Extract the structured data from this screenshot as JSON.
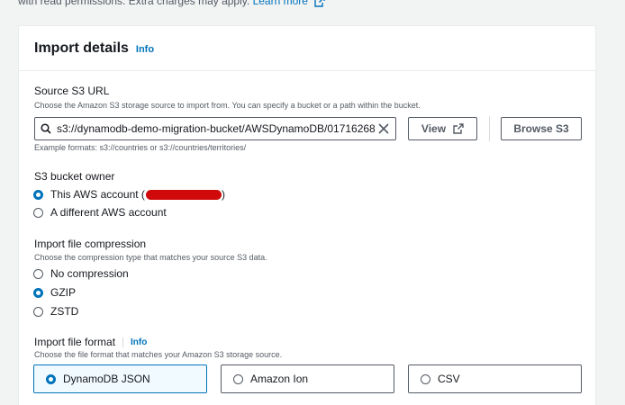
{
  "top_note": {
    "text": "with read permissions. Extra charges may apply.",
    "link": "Learn more"
  },
  "panel": {
    "title": "Import details",
    "info": "Info"
  },
  "source_s3": {
    "label": "Source S3 URL",
    "description": "Choose the Amazon S3 storage source to import from. You can specify a bucket or a path within the bucket.",
    "value": "s3://dynamodb-demo-migration-bucket/AWSDynamoDB/01716268",
    "example": "Example formats: s3://countries or s3://countries/territories/",
    "view_button": "View",
    "browse_button": "Browse S3"
  },
  "bucket_owner": {
    "label": "S3 bucket owner",
    "options": [
      "This AWS account (",
      "A different AWS account"
    ],
    "selected": 0,
    "closing": ")"
  },
  "compression": {
    "label": "Import file compression",
    "description": "Choose the compression type that matches your source S3 data.",
    "options": [
      "No compression",
      "GZIP",
      "ZSTD"
    ],
    "selected": 1
  },
  "format": {
    "label": "Import file format",
    "info": "Info",
    "description": "Choose the file format that matches your Amazon S3 storage source.",
    "options": [
      "DynamoDB JSON",
      "Amazon Ion",
      "CSV"
    ],
    "selected": 0
  },
  "colors": {
    "accent": "#0073bb",
    "border": "#545b64",
    "redaction": "#d00a0a"
  }
}
